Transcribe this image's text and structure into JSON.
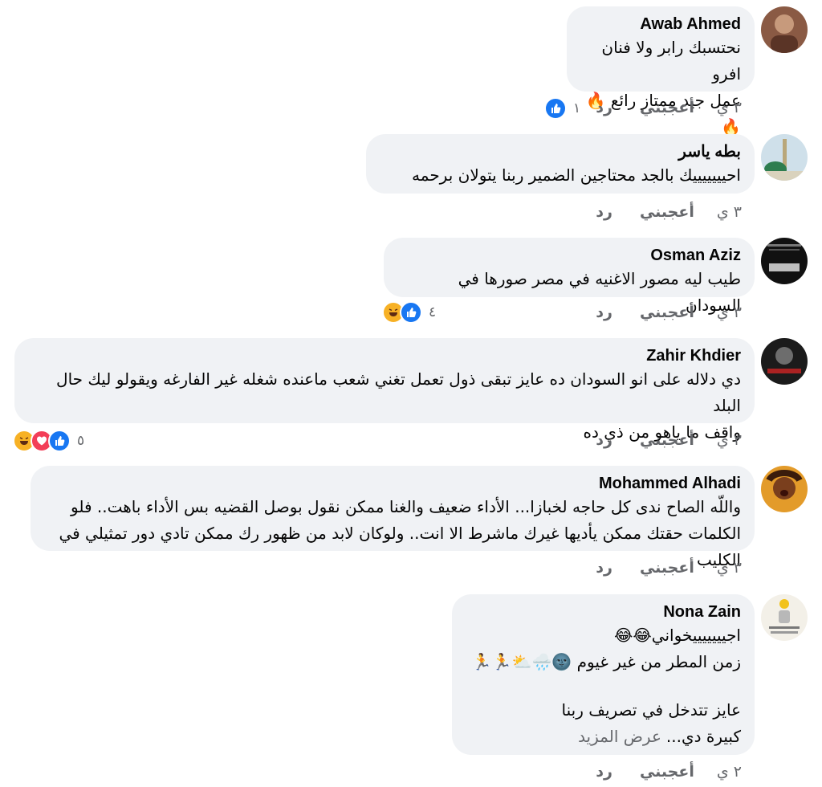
{
  "comments": [
    {
      "author": "Awab Ahmed",
      "lines": [
        "نحتسبك رابر ولا فنان افرو",
        "عمل جيد ممتاز رائع 🔥🔥"
      ],
      "time": "٣ ي",
      "like_label": "أعجبني",
      "reply_label": "رد",
      "reaction_count": "١",
      "reactions": [
        "like"
      ]
    },
    {
      "author": "بطه ياسر",
      "lines": [
        "احيييييييك بالجد محتاجين الضمير ربنا يتولان برحمه"
      ],
      "time": "٣ ي",
      "like_label": "أعجبني",
      "reply_label": "رد",
      "reaction_count": "",
      "reactions": []
    },
    {
      "author": "Osman Aziz",
      "lines": [
        "طيب ليه مصور الاغنيه في مصر صورها في السودان"
      ],
      "time": "٣ ي",
      "like_label": "أعجبني",
      "reply_label": "رد",
      "reaction_count": "٤",
      "reactions": [
        "like",
        "haha"
      ]
    },
    {
      "author": "Zahir Khdier",
      "lines": [
        "دي دلاله على انو السودان ده عايز تبقى ذول تعمل تغني شعب ماعنده شغله غير الفارغه ويقولو ليك حال البلد",
        "واقف ما ياهو من ذي ده"
      ],
      "time": "٣ ي",
      "like_label": "أعجبني",
      "reply_label": "رد",
      "reaction_count": "٥",
      "reactions": [
        "like",
        "love",
        "haha"
      ]
    },
    {
      "author": "Mohammed Alhadi",
      "lines": [
        "واللّه الصاح ندى كل حاجه لخبازا... الأداء ضعيف والغنا ممكن نقول بوصل القضيه بس الأداء باهت.. فلو",
        "الكلمات حقتك ممكن يأديها غيرك ماشرط الا انت.. ولوكان لابد من ظهور رك  ممكن تادي دور تمثيلي في الكليب"
      ],
      "time": "٣ ي",
      "like_label": "أعجبني",
      "reply_label": "رد",
      "reaction_count": "",
      "reactions": []
    },
    {
      "author": "Nona Zain",
      "lines": [
        "اجيييييييخواني😂😂",
        "زمن المطر من غير غيوم 🌚🌧️⛅🏃🏃",
        "",
        "عايز تتدخل في تصريف ربنا"
      ],
      "last_line": "كبيرة دي...",
      "see_more": "عرض المزيد",
      "time": "٢ ي",
      "like_label": "أعجبني",
      "reply_label": "رد",
      "reaction_count": "",
      "reactions": []
    }
  ],
  "colors": {
    "bubble_bg": "#f0f2f5",
    "secondary_text": "#65676b",
    "like_blue": "#1877f2",
    "love_red": "#f33e58",
    "haha_yellow": "#f7b125"
  }
}
